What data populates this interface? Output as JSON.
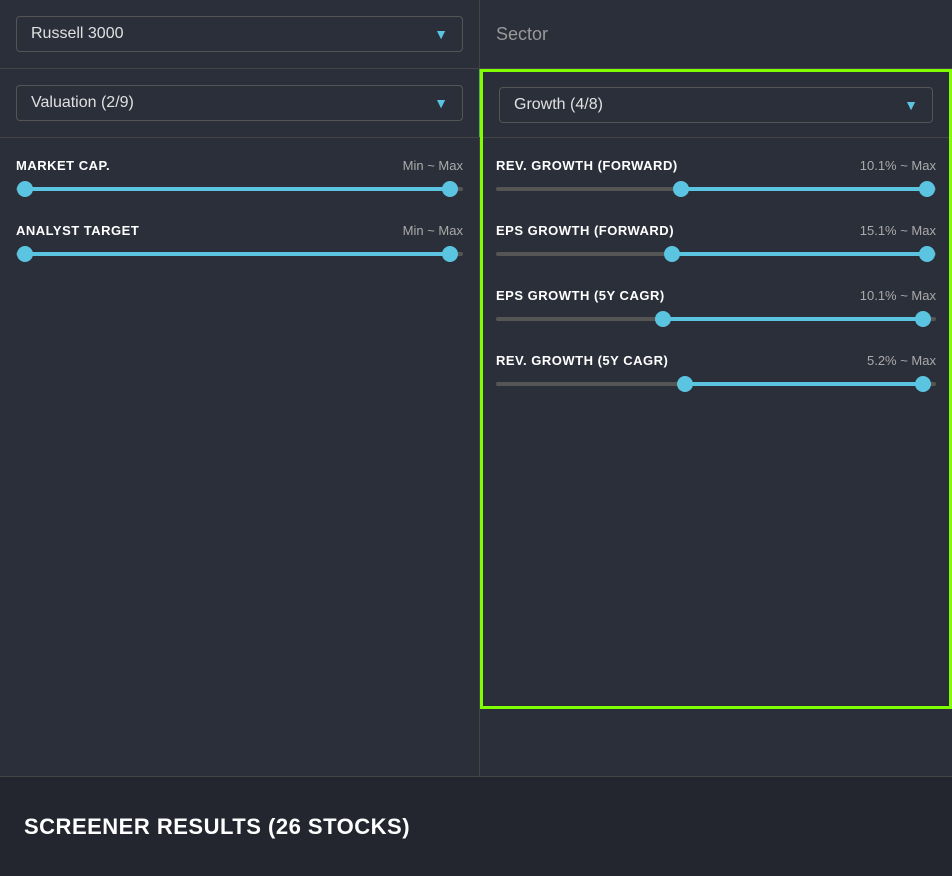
{
  "topbar": {
    "left_dropdown": "Russell 3000",
    "right_label": "Sector"
  },
  "filters_row": {
    "left_dropdown": "Valuation (2/9)",
    "right_dropdown": "Growth (4/8)"
  },
  "left_panel": {
    "market_cap": {
      "title": "MARKET CAP.",
      "range": "Min ~ Max",
      "thumb_left_pct": 2,
      "thumb_right_pct": 97
    },
    "analyst_target": {
      "title": "ANALYST TARGET",
      "range": "Min ~ Max",
      "thumb_left_pct": 2,
      "thumb_right_pct": 97
    }
  },
  "right_panel": {
    "rev_growth_forward": {
      "title": "REV. GROWTH (FORWARD)",
      "range": "10.1% ~ Max",
      "thumb_left_pct": 42,
      "thumb_right_pct": 98
    },
    "eps_growth_forward": {
      "title": "EPS GROWTH (FORWARD)",
      "range": "15.1% ~ Max",
      "thumb_left_pct": 40,
      "thumb_right_pct": 98
    },
    "eps_growth_5y": {
      "title": "EPS GROWTH (5Y CAGR)",
      "range": "10.1% ~ Max",
      "thumb_left_pct": 38,
      "thumb_right_pct": 97
    },
    "rev_growth_5y": {
      "title": "REV. GROWTH (5Y CAGR)",
      "range": "5.2% ~ Max",
      "thumb_left_pct": 43,
      "thumb_right_pct": 97
    }
  },
  "screener": {
    "title": "SCREENER RESULTS  (26 STOCKS)"
  }
}
